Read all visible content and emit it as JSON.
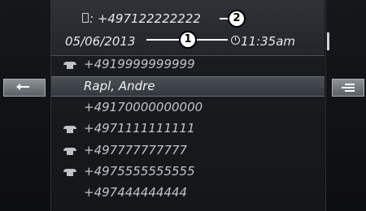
{
  "header": {
    "number": ": +497122222222",
    "date": "05/06/2013",
    "time": "11:35am",
    "callouts": [
      "1",
      "2"
    ]
  },
  "list": {
    "rows": [
      {
        "text": "+4919999999999",
        "icon": "handset-icon"
      },
      {
        "text": "Rapl, Andre",
        "icon": "",
        "selected": true
      },
      {
        "text": "+49170000000000",
        "icon": ""
      },
      {
        "text": "+4971111111111",
        "icon": "handset-icon"
      },
      {
        "text": "+497777777777",
        "icon": "handset-icon"
      },
      {
        "text": "+4975555555555",
        "icon": "handset-icon"
      },
      {
        "text": "+497444444444",
        "icon": ""
      }
    ]
  },
  "colors": {
    "accent": "#bfc3c8",
    "selected_bg": "#4a4f56"
  }
}
